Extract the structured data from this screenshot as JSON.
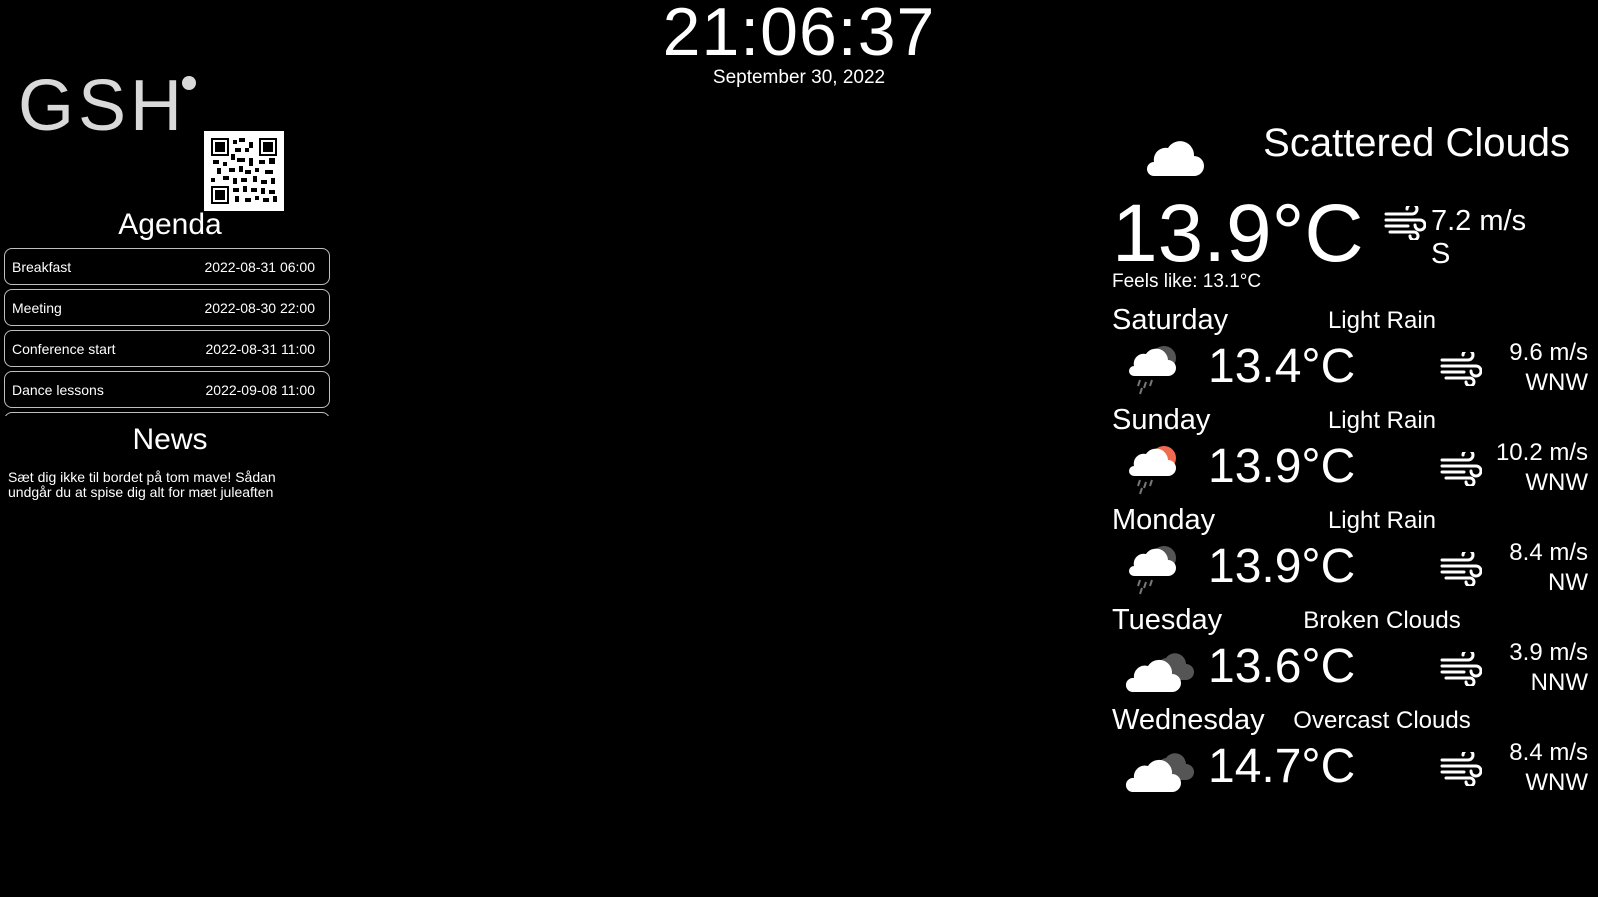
{
  "clock": {
    "time": "21:06:37",
    "date": "September 30, 2022"
  },
  "logo": {
    "text": "GSH"
  },
  "agenda": {
    "title": "Agenda",
    "items": [
      {
        "name": "Breakfast",
        "when": "2022-08-31 06:00"
      },
      {
        "name": "Meeting",
        "when": "2022-08-30 22:00"
      },
      {
        "name": "Conference start",
        "when": "2022-08-31 11:00"
      },
      {
        "name": "Dance lessons",
        "when": "2022-09-08 11:00"
      }
    ]
  },
  "news": {
    "title": "News",
    "headline": "Sæt dig ikke til bordet på tom mave! Sådan undgår du at spise dig alt for mæt juleaften"
  },
  "weather": {
    "current": {
      "description": "Scattered Clouds",
      "temp": "13.9°C",
      "wind_speed": "7.2 m/s",
      "wind_dir": "S",
      "feels_like": "Feels like: 13.1°C",
      "icon": "cloud-icon"
    },
    "forecast": [
      {
        "day": "Saturday",
        "desc": "Light Rain",
        "temp": "13.4°C",
        "wind_speed": "9.6 m/s",
        "wind_dir": "WNW",
        "icon": "rain-night-icon"
      },
      {
        "day": "Sunday",
        "desc": "Light Rain",
        "temp": "13.9°C",
        "wind_speed": "10.2 m/s",
        "wind_dir": "WNW",
        "icon": "rain-sun-icon"
      },
      {
        "day": "Monday",
        "desc": "Light Rain",
        "temp": "13.9°C",
        "wind_speed": "8.4 m/s",
        "wind_dir": "NW",
        "icon": "rain-night-icon"
      },
      {
        "day": "Tuesday",
        "desc": "Broken Clouds",
        "temp": "13.6°C",
        "wind_speed": "3.9 m/s",
        "wind_dir": "NNW",
        "icon": "broken-clouds-icon"
      },
      {
        "day": "Wednesday",
        "desc": "Overcast Clouds",
        "temp": "14.7°C",
        "wind_speed": "8.4 m/s",
        "wind_dir": "WNW",
        "icon": "overcast-clouds-icon"
      }
    ]
  },
  "colors": {
    "background": "#000000",
    "text": "#ffffff",
    "sun": "#f06b4f",
    "dark_cloud": "#555555"
  }
}
